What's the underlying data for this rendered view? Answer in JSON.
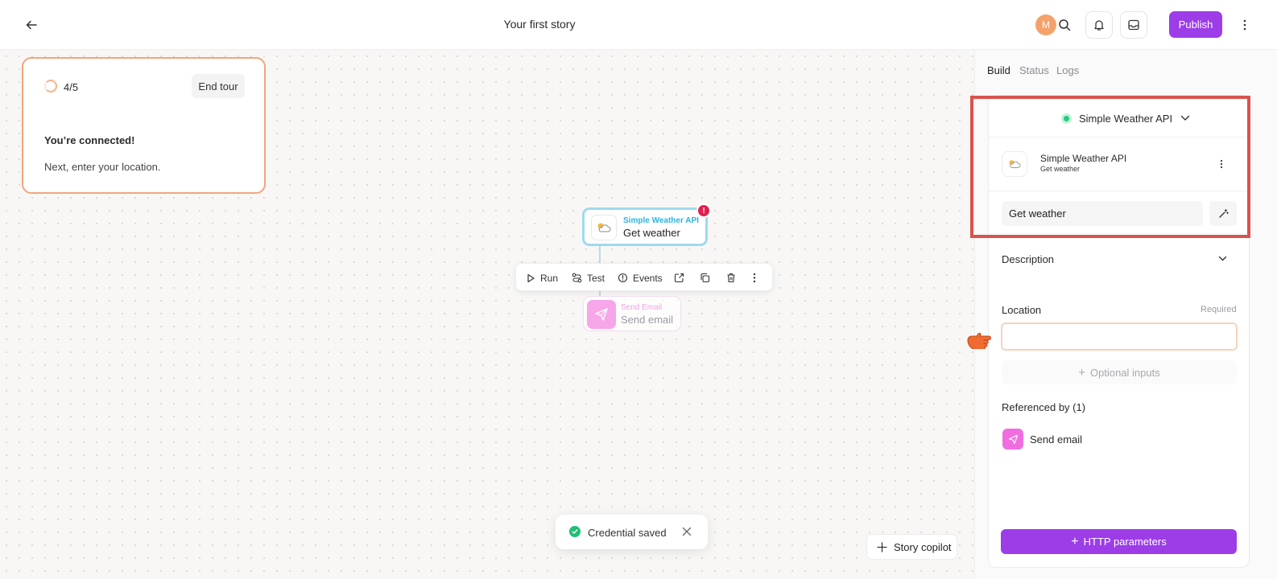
{
  "header": {
    "title": "Your first story",
    "avatar_initial": "M",
    "publish_label": "Publish"
  },
  "tour": {
    "step": "4/5",
    "end_label": "End tour",
    "heading": "You’re connected!",
    "body": "Next, enter your location."
  },
  "canvas": {
    "weather_node": {
      "app": "Simple Weather API",
      "action": "Get weather",
      "error_badge": "!"
    },
    "toolbar": {
      "run": "Run",
      "test": "Test",
      "events": "Events"
    },
    "email_node": {
      "app": "Send Email",
      "action": "Send email"
    },
    "toast": "Credential saved",
    "copilot": "Story copilot"
  },
  "panel": {
    "tabs": [
      "Build",
      "Status",
      "Logs"
    ],
    "app_selector": "Simple Weather API",
    "app_row": {
      "name": "Simple Weather API",
      "action": "Get weather"
    },
    "action_name_value": "Get weather",
    "description_label": "Description",
    "location": {
      "label": "Location",
      "required": "Required",
      "value": ""
    },
    "optional_inputs": "Optional inputs",
    "referenced_by": "Referenced by (1)",
    "referenced_items": [
      "Send email"
    ],
    "http_parameters": "HTTP parameters"
  },
  "colors": {
    "accent": "#9c3de8",
    "node_highlight": "#9ed9ef",
    "error": "#e2204e",
    "success": "#1fbf75",
    "highlight_box": "#d9534f",
    "tour_border": "#f0a67b"
  }
}
